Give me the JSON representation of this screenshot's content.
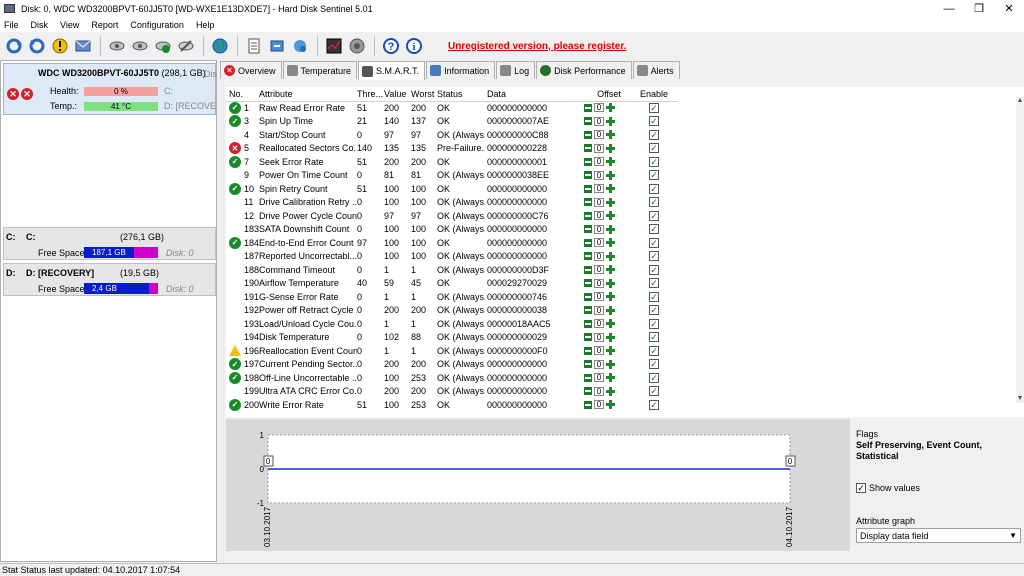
{
  "title": "Disk: 0, WDC WD3200BPVT-60JJ5T0 [WD-WXE1E13DXDE7] - Hard Disk Sentinel 5.01",
  "window_buttons": {
    "minimize": "—",
    "restore": "❐",
    "close": "✕"
  },
  "menu": [
    "File",
    "Disk",
    "View",
    "Report",
    "Configuration",
    "Help"
  ],
  "unregistered": "Unregistered version, please register.",
  "disk": {
    "name": "WDC WD3200BPVT-60JJ5T0",
    "size": "(298,1 GB)",
    "cut_note": "Dis",
    "health_label": "Health:",
    "health_value": "0 %",
    "health_drive": "C:",
    "temp_label": "Temp.:",
    "temp_value": "41 °C",
    "temp_drive": "D: [RECOVERY"
  },
  "partitions": [
    {
      "letter": "C:",
      "name": "C:",
      "size": "(276,1 GB)",
      "free_label": "Free Space",
      "free": "187,1 GB",
      "free_fraction": 0.68,
      "disk": "Disk: 0"
    },
    {
      "letter": "D:",
      "name": "D: [RECOVERY]",
      "size": "(19,5 GB)",
      "free_label": "Free Space",
      "free": "2,4 GB",
      "free_fraction": 0.88,
      "disk": "Disk: 0"
    }
  ],
  "tabs": [
    {
      "label": "Overview",
      "icon": "error-icon",
      "color": "#d3202a"
    },
    {
      "label": "Temperature",
      "icon": "thermometer-icon",
      "color": "#888888"
    },
    {
      "label": "S.M.A.R.T.",
      "icon": "smart-icon",
      "color": "#555555"
    },
    {
      "label": "Information",
      "icon": "info-icon",
      "color": "#4a7ab8"
    },
    {
      "label": "Log",
      "icon": "log-icon",
      "color": "#888888"
    },
    {
      "label": "Disk Performance",
      "icon": "performance-icon",
      "color": "#2a6a2a"
    },
    {
      "label": "Alerts",
      "icon": "alerts-icon",
      "color": "#888888"
    }
  ],
  "smart_headers": {
    "no": "No.",
    "attribute": "Attribute",
    "threshold": "Thre...",
    "value": "Value",
    "worst": "Worst",
    "status": "Status",
    "data": "Data",
    "offset": "Offset",
    "enable": "Enable"
  },
  "smart_rows": [
    {
      "icon": "ok",
      "no": "1",
      "attribute": "Raw Read Error Rate",
      "threshold": "51",
      "value": "200",
      "worst": "200",
      "status": "OK",
      "data": "000000000000",
      "offset": "0"
    },
    {
      "icon": "ok",
      "no": "3",
      "attribute": "Spin Up Time",
      "threshold": "21",
      "value": "140",
      "worst": "137",
      "status": "OK",
      "data": "0000000007AE",
      "offset": "0"
    },
    {
      "icon": "",
      "no": "4",
      "attribute": "Start/Stop Count",
      "threshold": "0",
      "value": "97",
      "worst": "97",
      "status": "OK (Always...",
      "data": "000000000C88",
      "offset": "0"
    },
    {
      "icon": "bad",
      "no": "5",
      "attribute": "Reallocated Sectors Co...",
      "threshold": "140",
      "value": "135",
      "worst": "135",
      "status": "Pre-Failure...",
      "data": "000000000228",
      "offset": "0"
    },
    {
      "icon": "ok",
      "no": "7",
      "attribute": "Seek Error Rate",
      "threshold": "51",
      "value": "200",
      "worst": "200",
      "status": "OK",
      "data": "000000000001",
      "offset": "0"
    },
    {
      "icon": "",
      "no": "9",
      "attribute": "Power On Time Count",
      "threshold": "0",
      "value": "81",
      "worst": "81",
      "status": "OK (Always...",
      "data": "0000000038EE",
      "offset": "0"
    },
    {
      "icon": "ok",
      "no": "10",
      "attribute": "Spin Retry Count",
      "threshold": "51",
      "value": "100",
      "worst": "100",
      "status": "OK",
      "data": "000000000000",
      "offset": "0"
    },
    {
      "icon": "",
      "no": "11",
      "attribute": "Drive Calibration Retry ...",
      "threshold": "0",
      "value": "100",
      "worst": "100",
      "status": "OK (Always...",
      "data": "000000000000",
      "offset": "0"
    },
    {
      "icon": "",
      "no": "12",
      "attribute": "Drive Power Cycle Count",
      "threshold": "0",
      "value": "97",
      "worst": "97",
      "status": "OK (Always...",
      "data": "000000000C76",
      "offset": "0"
    },
    {
      "icon": "",
      "no": "183",
      "attribute": "SATA Downshift Count",
      "threshold": "0",
      "value": "100",
      "worst": "100",
      "status": "OK (Always...",
      "data": "000000000000",
      "offset": "0"
    },
    {
      "icon": "ok",
      "no": "184",
      "attribute": "End-to-End Error Count",
      "threshold": "97",
      "value": "100",
      "worst": "100",
      "status": "OK",
      "data": "000000000000",
      "offset": "0"
    },
    {
      "icon": "",
      "no": "187",
      "attribute": "Reported Uncorrectabl...",
      "threshold": "0",
      "value": "100",
      "worst": "100",
      "status": "OK (Always...",
      "data": "000000000000",
      "offset": "0"
    },
    {
      "icon": "",
      "no": "188",
      "attribute": "Command Timeout",
      "threshold": "0",
      "value": "1",
      "worst": "1",
      "status": "OK (Always...",
      "data": "000000000D3F",
      "offset": "0"
    },
    {
      "icon": "",
      "no": "190",
      "attribute": "Airflow Temperature",
      "threshold": "40",
      "value": "59",
      "worst": "45",
      "status": "OK",
      "data": "000029270029",
      "offset": "0"
    },
    {
      "icon": "",
      "no": "191",
      "attribute": "G-Sense Error Rate",
      "threshold": "0",
      "value": "1",
      "worst": "1",
      "status": "OK (Always...",
      "data": "000000000746",
      "offset": "0"
    },
    {
      "icon": "",
      "no": "192",
      "attribute": "Power off Retract Cycle ...",
      "threshold": "0",
      "value": "200",
      "worst": "200",
      "status": "OK (Always...",
      "data": "000000000038",
      "offset": "0"
    },
    {
      "icon": "",
      "no": "193",
      "attribute": "Load/Unload Cycle Cou...",
      "threshold": "0",
      "value": "1",
      "worst": "1",
      "status": "OK (Always...",
      "data": "00000018AAC5",
      "offset": "0"
    },
    {
      "icon": "",
      "no": "194",
      "attribute": "Disk Temperature",
      "threshold": "0",
      "value": "102",
      "worst": "88",
      "status": "OK (Always...",
      "data": "000000000029",
      "offset": "0"
    },
    {
      "icon": "warn",
      "no": "196",
      "attribute": "Reallocation Event Count",
      "threshold": "0",
      "value": "1",
      "worst": "1",
      "status": "OK (Always...",
      "data": "0000000000F0",
      "offset": "0"
    },
    {
      "icon": "ok",
      "no": "197",
      "attribute": "Current Pending Sector...",
      "threshold": "0",
      "value": "200",
      "worst": "200",
      "status": "OK (Always...",
      "data": "000000000000",
      "offset": "0"
    },
    {
      "icon": "ok",
      "no": "198",
      "attribute": "Off-Line Uncorrectable ...",
      "threshold": "0",
      "value": "100",
      "worst": "253",
      "status": "OK (Always...",
      "data": "000000000000",
      "offset": "0"
    },
    {
      "icon": "",
      "no": "199",
      "attribute": "Ultra ATA CRC Error Co...",
      "threshold": "0",
      "value": "200",
      "worst": "200",
      "status": "OK (Always...",
      "data": "000000000000",
      "offset": "0"
    },
    {
      "icon": "ok",
      "no": "200",
      "attribute": "Write Error Rate",
      "threshold": "51",
      "value": "100",
      "worst": "253",
      "status": "OK",
      "data": "000000000000",
      "offset": "0"
    }
  ],
  "graph": {
    "y_ticks": [
      "1",
      "0",
      "-1"
    ],
    "x_start": "03.10.2017",
    "x_end": "04.10.2017",
    "point_labels": [
      "0",
      "0"
    ],
    "line_color": "#1a2ad8"
  },
  "flags": {
    "title": "Flags",
    "description": "Self Preserving, Event Count, Statistical",
    "show_values_label": "Show values",
    "show_values_checked": true,
    "attribute_graph_label": "Attribute graph",
    "attribute_graph_value": "Display data field"
  },
  "status_bar": "Stat Status last updated: 04.10.2017 1:07:54"
}
